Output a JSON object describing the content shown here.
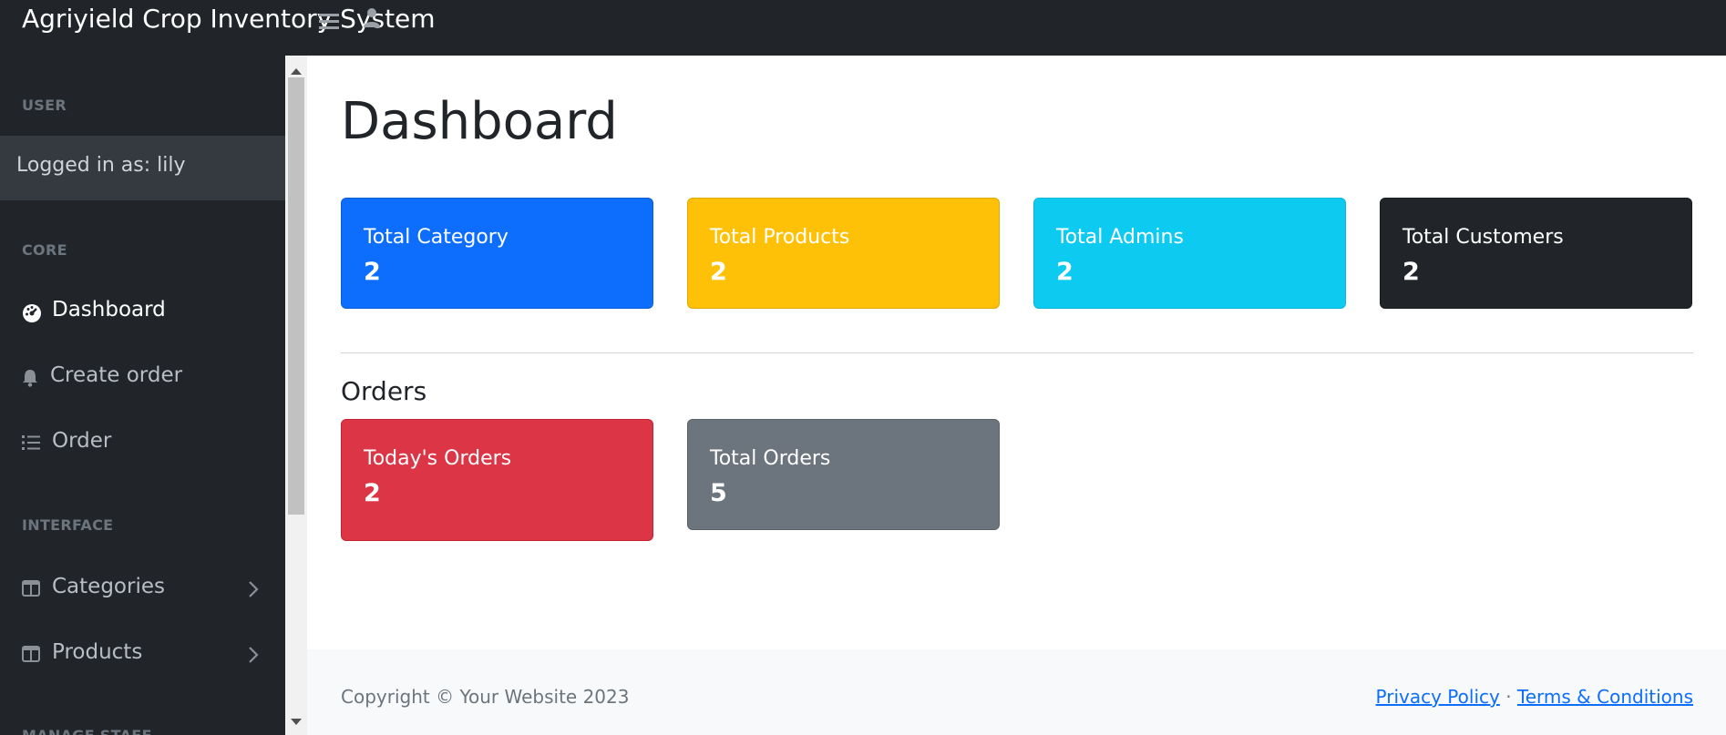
{
  "app": {
    "brand": "Agriyield Crop Inventory System"
  },
  "sidebar": {
    "user_heading": "USER",
    "logged_in": "Logged in as: lily",
    "core_heading": "CORE",
    "core_items": [
      {
        "label": "Dashboard",
        "icon": "tachometer-icon",
        "active": true
      },
      {
        "label": "Create order",
        "icon": "bell-icon"
      },
      {
        "label": "Order",
        "icon": "list-icon"
      }
    ],
    "interface_heading": "INTERFACE",
    "interface_items": [
      {
        "label": "Categories",
        "icon": "columns-icon"
      },
      {
        "label": "Products",
        "icon": "columns-icon"
      }
    ],
    "manage_heading": "MANAGE STAFF"
  },
  "main": {
    "title": "Dashboard",
    "stats": [
      {
        "label": "Total Category",
        "value": "2",
        "color": "#0d6efd"
      },
      {
        "label": "Total Products",
        "value": "2",
        "color": "#ffc107"
      },
      {
        "label": "Total Admins",
        "value": "2",
        "color": "#0dcaf0"
      },
      {
        "label": "Total Customers",
        "value": "2",
        "color": "#212529"
      }
    ],
    "orders_title": "Orders",
    "orders": [
      {
        "label": "Today's Orders",
        "value": "2",
        "color": "#dc3545"
      },
      {
        "label": "Total Orders",
        "value": "5",
        "color": "#6c757d"
      }
    ]
  },
  "footer": {
    "copyright": "Copyright © Your Website 2023",
    "privacy": "Privacy Policy",
    "separator": "·",
    "terms": "Terms & Conditions"
  }
}
